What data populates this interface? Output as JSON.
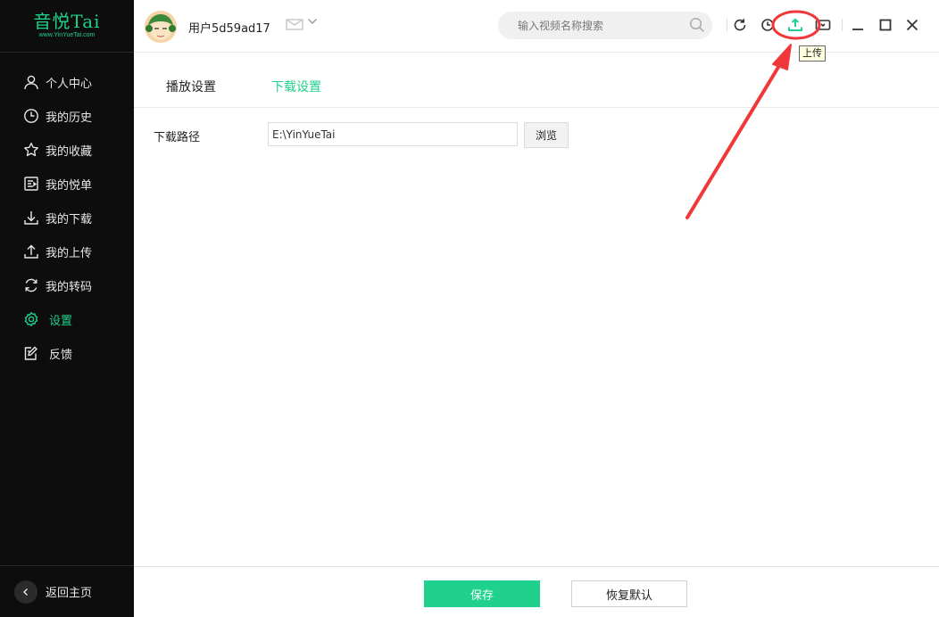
{
  "app": {
    "logo_text": "音悦Tai",
    "logo_sub": "www.YinYueTai.com"
  },
  "sidebar": {
    "items": [
      {
        "label": "个人中心",
        "icon": "user-icon"
      },
      {
        "label": "我的历史",
        "icon": "clock-icon"
      },
      {
        "label": "我的收藏",
        "icon": "star-icon"
      },
      {
        "label": "我的悦单",
        "icon": "playlist-icon"
      },
      {
        "label": "我的下载",
        "icon": "download-icon"
      },
      {
        "label": "我的上传",
        "icon": "upload-icon"
      },
      {
        "label": "我的转码",
        "icon": "convert-icon"
      },
      {
        "label": "设置",
        "icon": "gear-icon",
        "active": true
      },
      {
        "label": "反馈",
        "icon": "feedback-icon"
      }
    ],
    "back_label": "返回主页"
  },
  "header": {
    "username": "用户5d59ad17",
    "search_placeholder": "输入视频名称搜索",
    "upload_tooltip": "上传"
  },
  "tabs": [
    {
      "label": "播放设置",
      "active": false
    },
    {
      "label": "下载设置",
      "active": true
    }
  ],
  "settings": {
    "download_path_label": "下载路径",
    "download_path_value": "E:\\YinYueTai",
    "browse_label": "浏览"
  },
  "footer": {
    "save_label": "保存",
    "reset_label": "恢复默认"
  },
  "colors": {
    "accent": "#1fd18c",
    "sidebar_bg": "#0d0d0d",
    "annotation": "#f0383a"
  }
}
